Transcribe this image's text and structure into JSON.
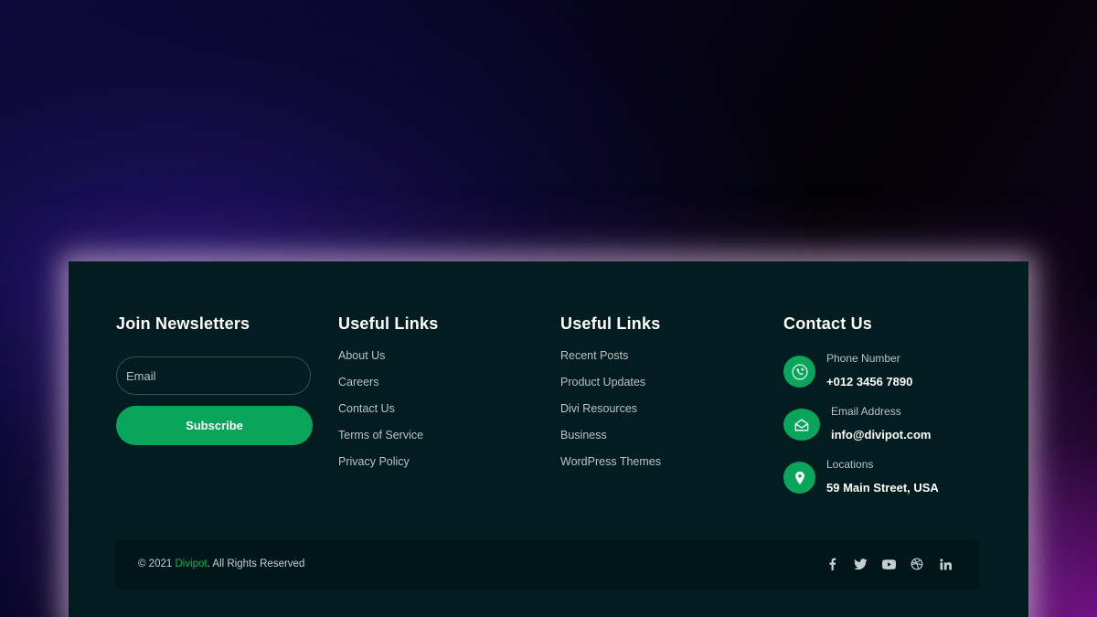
{
  "colors": {
    "accent": "#09a55b",
    "card_bg": "#021c1f",
    "bottom_bar_bg": "#011619",
    "muted_text": "#b9c3c4",
    "brand_text": "#14b35f"
  },
  "newsletter": {
    "heading": "Join Newsletters",
    "email_placeholder": "Email",
    "email_value": "",
    "subscribe_label": "Subscribe"
  },
  "links_col_1": {
    "heading": "Useful Links",
    "items": [
      "About Us",
      "Careers",
      "Contact Us",
      "Terms of Service",
      "Privacy Policy"
    ]
  },
  "links_col_2": {
    "heading": "Useful Links",
    "items": [
      "Recent Posts",
      "Product Updates",
      "Divi Resources",
      "Business",
      "WordPress Themes"
    ]
  },
  "contact": {
    "heading": "Contact Us",
    "items": [
      {
        "icon": "phone-icon",
        "label": "Phone Number",
        "value": "+012 3456 7890"
      },
      {
        "icon": "email-icon",
        "label": "Email Address",
        "value": "info@divipot.com"
      },
      {
        "icon": "location-pin-icon",
        "label": "Locations",
        "value": "59 Main Street, USA"
      }
    ]
  },
  "footer_bottom": {
    "copyright_prefix": "© 2021 ",
    "brand": "Divipot",
    "copyright_suffix": ". All Rights Reserved",
    "social_icons": [
      "facebook-icon",
      "twitter-icon",
      "youtube-icon",
      "dribbble-icon",
      "linkedin-icon"
    ]
  }
}
